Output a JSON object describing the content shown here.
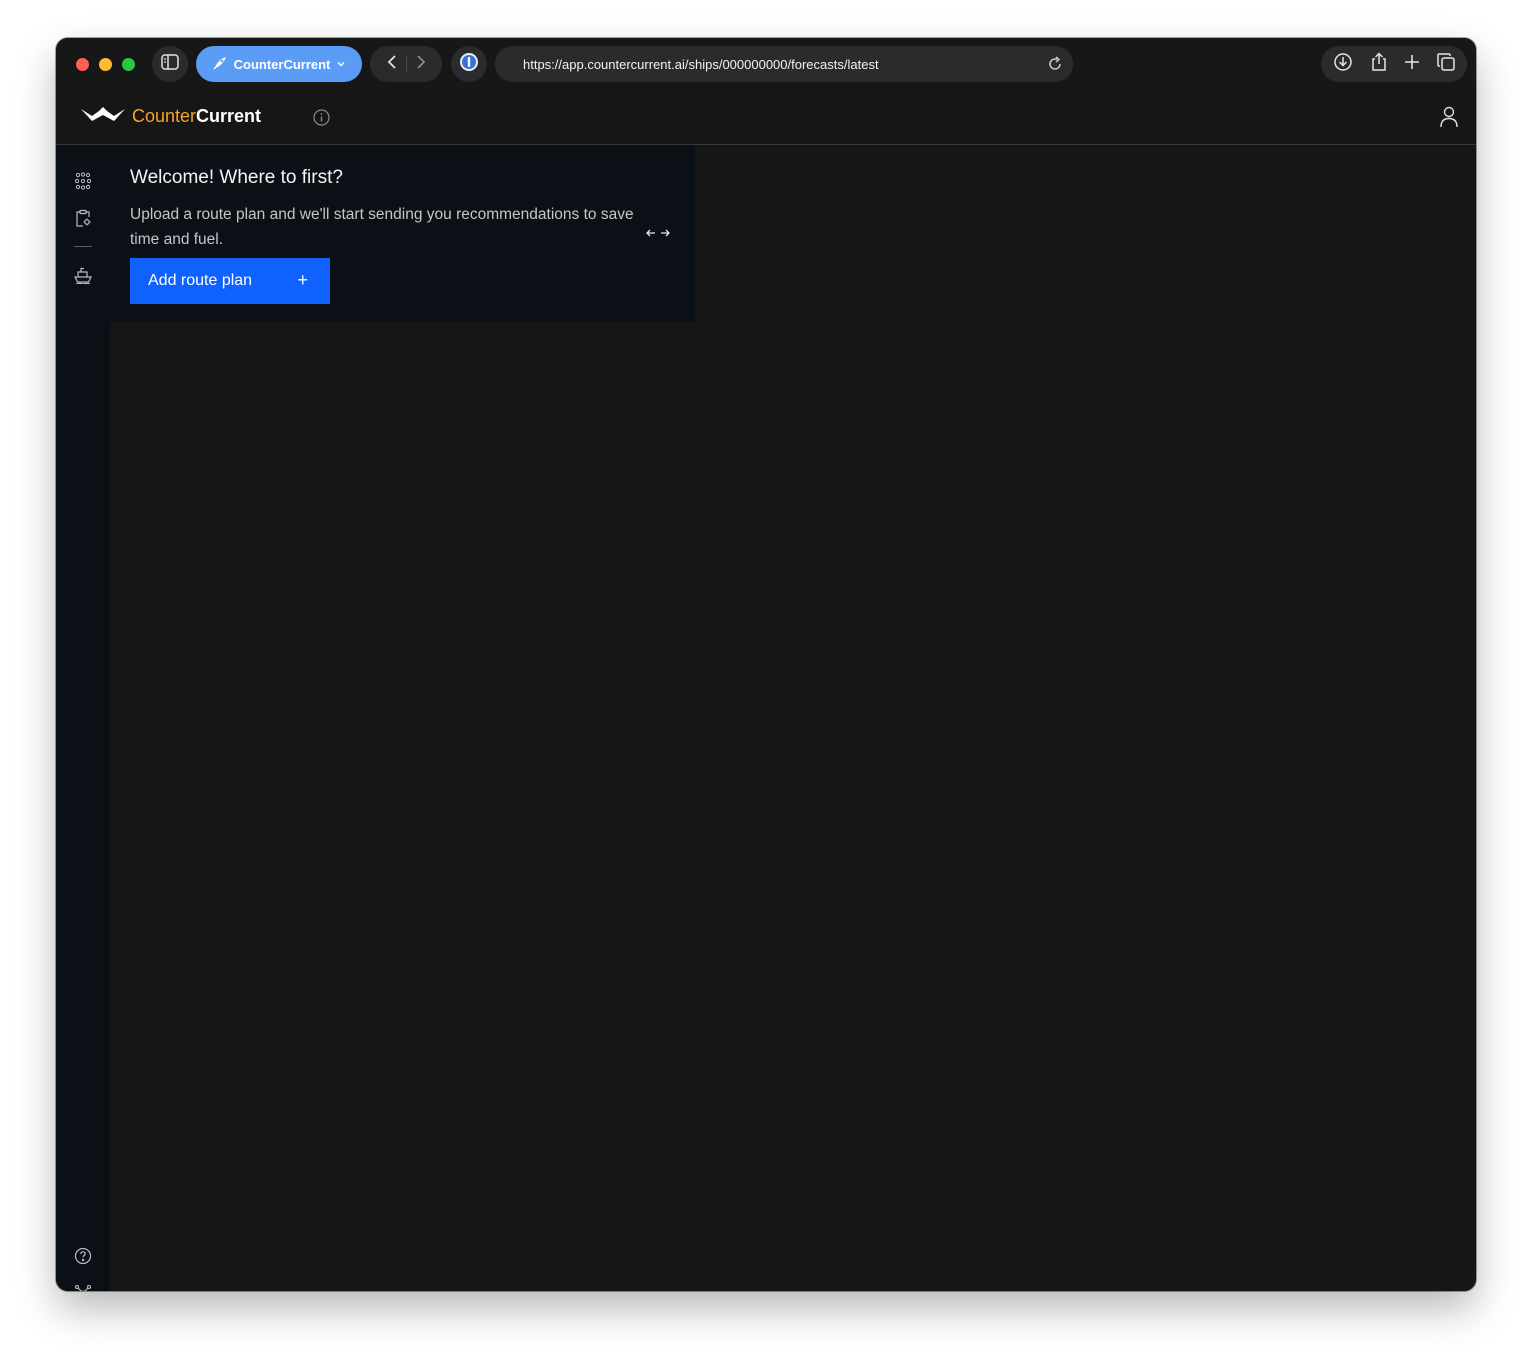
{
  "browser": {
    "tab_group_label": "CounterCurrent",
    "url": "https://app.countercurrent.ai/ships/000000000/forecasts/latest",
    "icons": {
      "sidebar": "sidebar-icon",
      "tab_group": "rocket-icon",
      "back": "chevron-left-icon",
      "forward": "chevron-right-icon",
      "extension": "password-manager-icon",
      "reload": "reload-icon",
      "download": "download-icon",
      "share": "share-icon",
      "new_tab": "plus-icon",
      "tabs_overview": "tabs-icon"
    },
    "accent_color": "#5b9cf6"
  },
  "app": {
    "logo_counter": "Counter",
    "logo_current": "Current",
    "brand_color": "#f5a623",
    "header_icons": [
      "info-icon",
      "user-icon"
    ]
  },
  "rail": {
    "items": [
      "fleet-icon",
      "clipboard-settings-icon",
      "ship-icon"
    ],
    "bottom_items": [
      "help-icon",
      "network-icon"
    ]
  },
  "welcome": {
    "title": "Welcome! Where to first?",
    "body": "Upload a route plan and we'll start sending you recommendations to save time and fuel.",
    "button_label": "Add route plan",
    "button_icon": "+",
    "button_color": "#0f62fe"
  }
}
